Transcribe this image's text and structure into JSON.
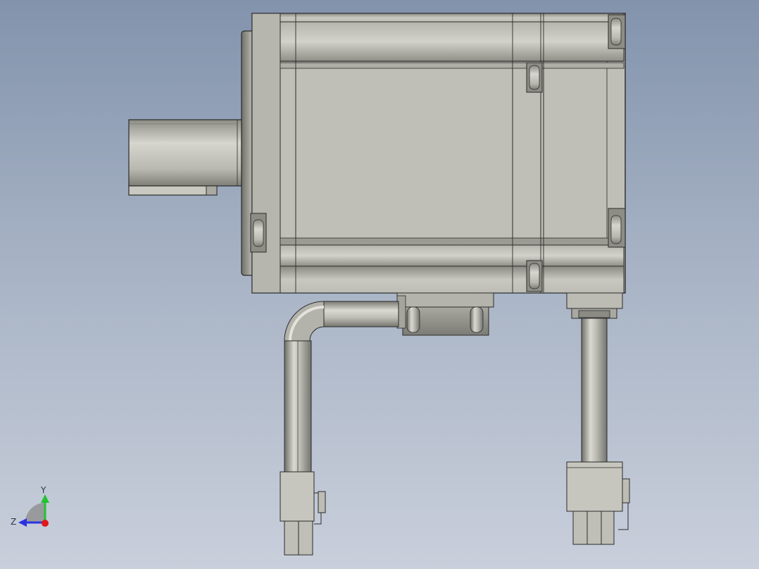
{
  "viewport": {
    "background_top": "#8293ac",
    "background_bottom": "#c9cfdb"
  },
  "model": {
    "body_color": "#bfbfb7",
    "edge_color": "#2b2b2b"
  },
  "triad": {
    "y_label": "Y",
    "z_label": "Z",
    "y_color": "#22c232",
    "z_color": "#2a32e0",
    "origin_color": "#e01818"
  }
}
